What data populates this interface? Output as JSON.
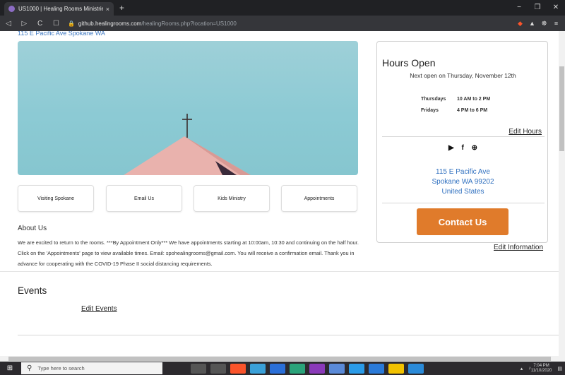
{
  "browser": {
    "tab_title": "US1000 | Healing Rooms Ministrie",
    "tab_close": "×",
    "new_tab": "+",
    "url_domain": "github.healingrooms.com",
    "url_path": "/healingRooms.php?location=US1000",
    "nav": {
      "back": "◁",
      "forward": "▷",
      "reload": "C",
      "bookmark": "☐"
    },
    "lock": "🔒",
    "window_controls": {
      "minimize": "−",
      "restore": "❐",
      "close": "✕"
    },
    "extensions": {
      "brave": "◆",
      "alert": "▲",
      "puzzle": "☸",
      "menu": "≡"
    }
  },
  "page": {
    "cut_address": "115 E Pacific Ave Spokane WA",
    "buttons": {
      "visiting": "Visiting Spokane",
      "email": "Email Us",
      "kids": "Kids Ministry",
      "appointments": "Appointments"
    },
    "about": {
      "heading": "About Us",
      "text": "We are excited to return to the rooms. ***By Appointment Only*** We have appointments starting at 10:00am, 10:30 and continuing on the half hour. Click on the 'Appointments' page to view available times. Email: spohealingrooms@gmail.com. You will receive a confirmation email. Thank you in advance for cooperating with the COVID-19 Phase II social distancing requirements."
    },
    "hours": {
      "heading": "Hours Open",
      "next_open": "Next open on Thursday, November 12th",
      "rows": [
        {
          "day": "Thursdays",
          "time": "10 AM to 2 PM"
        },
        {
          "day": "Fridays",
          "time": "4 PM to 6 PM"
        }
      ],
      "edit_hours": "Edit Hours"
    },
    "social": {
      "youtube": "▶",
      "facebook": "f",
      "web": "⊕"
    },
    "address": {
      "line1": "115 E Pacific Ave",
      "line2": "Spokane WA 99202",
      "line3": "United States"
    },
    "contact_button": "Contact Us",
    "edit_information": "Edit Information",
    "events": {
      "heading": "Events",
      "edit_events": "Edit Events"
    }
  },
  "taskbar": {
    "search_placeholder": "Type here to search",
    "time": "7:04 PM",
    "date": "11/10/2020",
    "app_colors": [
      "#555",
      "#555",
      "#fb542b",
      "#3aa0d8",
      "#2a6fd8",
      "#2aa37a",
      "#8a3ab9",
      "#5a8ad8",
      "#2a9be8",
      "#2a7ad8",
      "#f2c200",
      "#2a8ad8"
    ]
  }
}
